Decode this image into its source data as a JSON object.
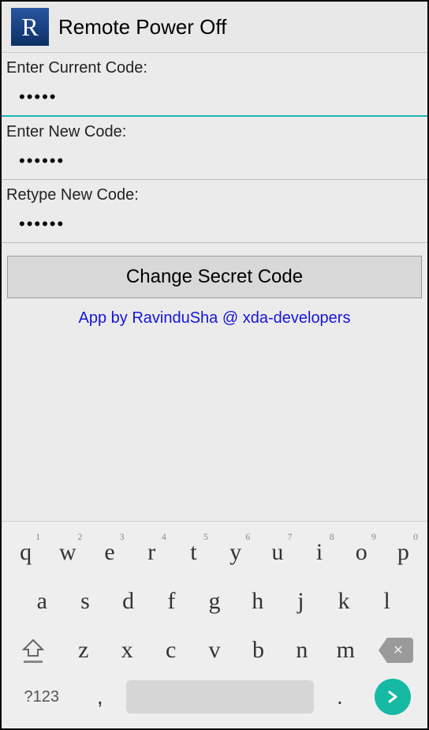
{
  "header": {
    "icon_letter": "R",
    "title": "Remote Power Off"
  },
  "fields": {
    "current": {
      "label": "Enter Current Code:",
      "value": "•••••"
    },
    "new": {
      "label": "Enter New Code:",
      "value": "••••••"
    },
    "retype": {
      "label": "Retype New Code:",
      "value": "••••••"
    }
  },
  "button": {
    "change_label": "Change Secret Code"
  },
  "credit": "App by RavinduSha @ xda-developers",
  "keyboard": {
    "row1": [
      {
        "k": "q",
        "n": "1"
      },
      {
        "k": "w",
        "n": "2"
      },
      {
        "k": "e",
        "n": "3"
      },
      {
        "k": "r",
        "n": "4"
      },
      {
        "k": "t",
        "n": "5"
      },
      {
        "k": "y",
        "n": "6"
      },
      {
        "k": "u",
        "n": "7"
      },
      {
        "k": "i",
        "n": "8"
      },
      {
        "k": "o",
        "n": "9"
      },
      {
        "k": "p",
        "n": "0"
      }
    ],
    "row2": [
      "a",
      "s",
      "d",
      "f",
      "g",
      "h",
      "j",
      "k",
      "l"
    ],
    "row3": [
      "z",
      "x",
      "c",
      "v",
      "b",
      "n",
      "m"
    ],
    "symnum": "?123",
    "comma": ",",
    "dot": "."
  }
}
